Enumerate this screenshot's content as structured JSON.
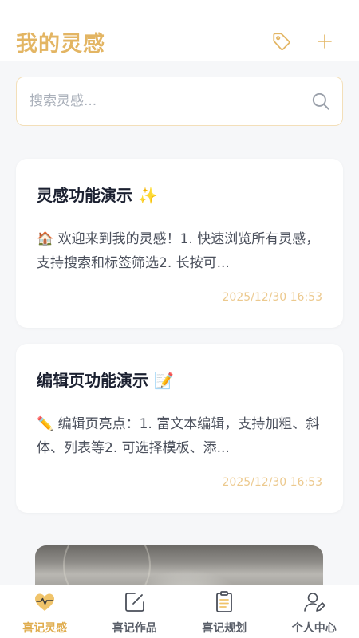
{
  "header": {
    "title": "我的灵感",
    "tag_icon": "tag-icon",
    "add_icon": "plus-icon"
  },
  "search": {
    "placeholder": "搜索灵感...",
    "value": "",
    "icon": "search-icon"
  },
  "notes": [
    {
      "title": "灵感功能演示 ✨",
      "preview": "🏠 欢迎来到我的灵感！1. 快速浏览所有灵感，支持搜索和标签筛选2. 长按可...",
      "time": "2025/12/30 16:53"
    },
    {
      "title": "编辑页功能演示 📝",
      "preview": "✏️ 编辑页亮点：1. 富文本编辑，支持加粗、斜体、列表等2. 可选择模板、添...",
      "time": "2025/12/30 16:53"
    }
  ],
  "tabbar": {
    "items": [
      {
        "label": "喜记灵感",
        "icon": "heart-pulse-icon",
        "active": true
      },
      {
        "label": "喜记作品",
        "icon": "edit-square-icon",
        "active": false
      },
      {
        "label": "喜记规划",
        "icon": "clipboard-list-icon",
        "active": false
      },
      {
        "label": "个人中心",
        "icon": "user-edit-icon",
        "active": false
      }
    ]
  },
  "colors": {
    "accent": "#e3b563",
    "accent_light": "#ecc98e",
    "background": "#f6f7f9",
    "text": "#1b2030"
  }
}
